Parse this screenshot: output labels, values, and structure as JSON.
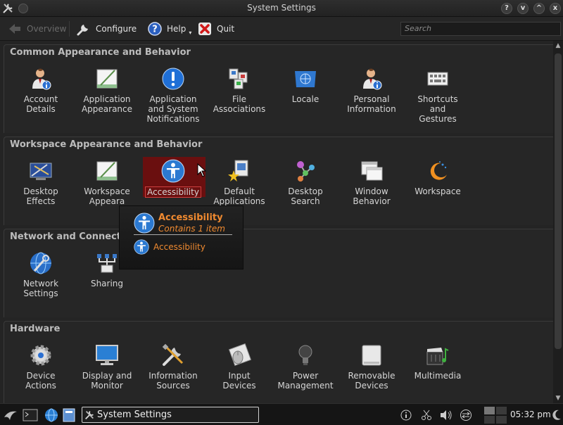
{
  "window": {
    "title": "System Settings",
    "controls": [
      "?",
      "v",
      "^",
      "x"
    ]
  },
  "toolbar": {
    "overview_label": "Overview",
    "configure_label": "Configure",
    "help_label": "Help",
    "quit_label": "Quit",
    "search_placeholder": "Search"
  },
  "sections": [
    {
      "title": "Common Appearance and Behavior",
      "items": [
        {
          "label": "Account\nDetails",
          "icon": "user-info-icon"
        },
        {
          "label": "Application\nAppearance",
          "icon": "palette-icon"
        },
        {
          "label": "Application\nand System\nNotifications",
          "icon": "notification-icon"
        },
        {
          "label": "File\nAssociations",
          "icon": "file-types-icon"
        },
        {
          "label": "Locale",
          "icon": "globe-flag-icon"
        },
        {
          "label": "Personal\nInformation",
          "icon": "personal-icon"
        },
        {
          "label": "Shortcuts\nand\nGestures",
          "icon": "keyboard-icon"
        }
      ]
    },
    {
      "title": "Workspace Appearance and Behavior",
      "items": [
        {
          "label": "Desktop\nEffects",
          "icon": "desktop-effects-icon"
        },
        {
          "label": "Workspace\nAppeara",
          "icon": "workspace-appearance-icon"
        },
        {
          "label": "Accessibility",
          "icon": "accessibility-icon"
        },
        {
          "label": "Default\nApplications",
          "icon": "default-apps-icon"
        },
        {
          "label": "Desktop\nSearch",
          "icon": "desktop-search-icon"
        },
        {
          "label": "Window\nBehavior",
          "icon": "window-icon"
        },
        {
          "label": "Workspace",
          "icon": "workspace-icon"
        }
      ]
    },
    {
      "title": "Network and Connecti",
      "items": [
        {
          "label": "Network\nSettings",
          "icon": "network-icon"
        },
        {
          "label": "Sharing",
          "icon": "sharing-icon"
        }
      ]
    },
    {
      "title": "Hardware",
      "items": [
        {
          "label": "Device\nActions",
          "icon": "gear-icon"
        },
        {
          "label": "Display and\nMonitor",
          "icon": "monitor-icon"
        },
        {
          "label": "Information\nSources",
          "icon": "tools-icon"
        },
        {
          "label": "Input\nDevices",
          "icon": "mouse-icon"
        },
        {
          "label": "Power\nManagement",
          "icon": "bulb-icon"
        },
        {
          "label": "Removable\nDevices",
          "icon": "drive-icon"
        },
        {
          "label": "Multimedia",
          "icon": "multimedia-icon"
        }
      ]
    }
  ],
  "tooltip": {
    "title": "Accessibility",
    "subtitle": "Contains 1 item",
    "row_label": "Accessibility"
  },
  "taskbar": {
    "task_label": "System Settings",
    "clock": "05:32 pm"
  },
  "colors": {
    "accent": "#f08a30",
    "selection": "#6a0f0f",
    "selection_border": "#d04040",
    "background": "#242424"
  }
}
